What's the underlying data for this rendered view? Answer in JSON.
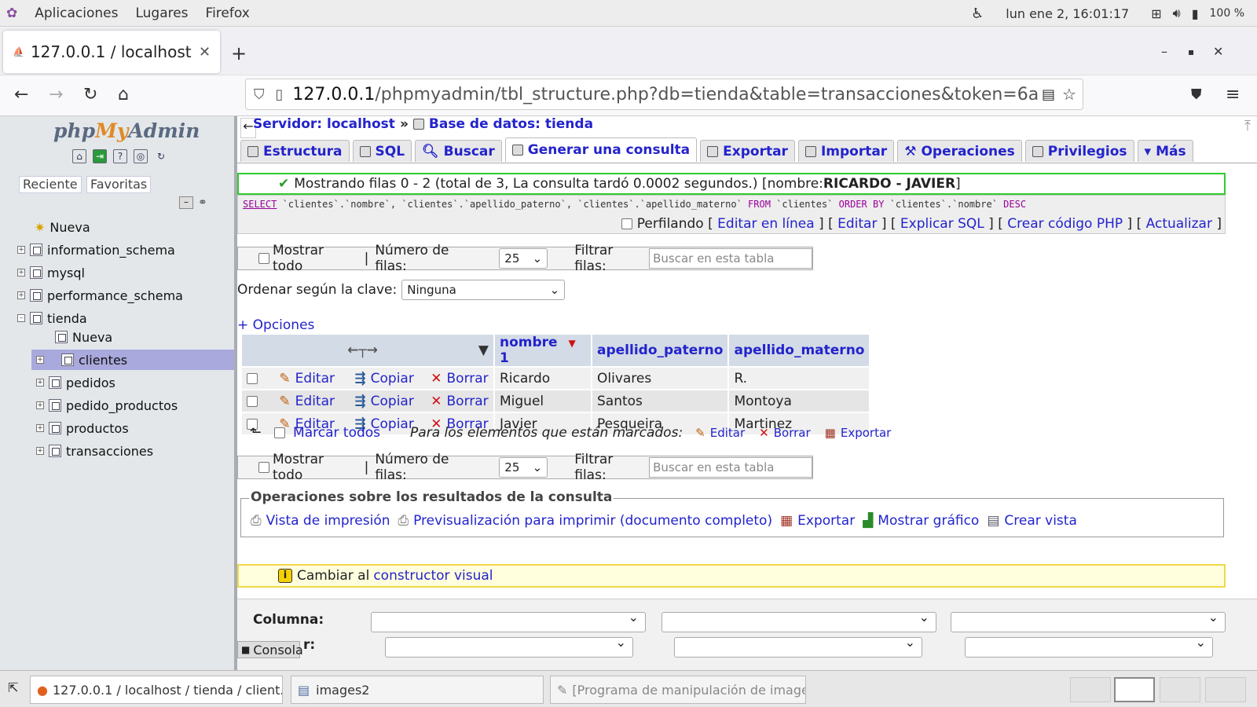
{
  "topbar": {
    "menu": [
      "Aplicaciones",
      "Lugares",
      "Firefox"
    ],
    "clock": "lun ene  2, 16:01:17",
    "battery": "100 %"
  },
  "browser": {
    "tab_title": "127.0.0.1 / localhost",
    "url_host": "127.0.0.1",
    "url_path": "/phpmyadmin/tbl_structure.php?db=tienda&table=transacciones&token=6a"
  },
  "sidebar": {
    "logo_php": "php",
    "logo_my": "My",
    "logo_admin": "Admin",
    "btn_recent": "Reciente",
    "btn_favorites": "Favoritas",
    "items": [
      {
        "label": "Nueva",
        "level": 0
      },
      {
        "label": "information_schema",
        "level": 0
      },
      {
        "label": "mysql",
        "level": 0
      },
      {
        "label": "performance_schema",
        "level": 0
      },
      {
        "label": "tienda",
        "level": 0
      },
      {
        "label": "Nueva",
        "level": 1
      },
      {
        "label": "clientes",
        "level": 1
      },
      {
        "label": "pedidos",
        "level": 1
      },
      {
        "label": "pedido_productos",
        "level": 1
      },
      {
        "label": "productos",
        "level": 1
      },
      {
        "label": "transacciones",
        "level": 1
      }
    ]
  },
  "breadcrumb": {
    "server": "Servidor: localhost",
    "sep": "»",
    "db": "Base de datos: tienda"
  },
  "tabs": [
    "Estructura",
    "SQL",
    "Buscar",
    "Generar una consulta",
    "Exportar",
    "Importar",
    "Operaciones",
    "Privilegios",
    "Más"
  ],
  "success": {
    "text": "Mostrando filas 0 - 2 (total de 3, La consulta tardó 0.0002 segundos.) [nombre: ",
    "bold": "RICARDO - JAVIER",
    "end": "]"
  },
  "sql": {
    "select_kw": "SELECT",
    "columns": " `clientes`.`nombre`, `clientes`.`apellido_paterno`, `clientes`.`apellido_materno` ",
    "from_kw": "FROM",
    "table": " `clientes` ",
    "order_kw": "ORDER BY",
    "order_col": " `clientes`.`nombre` ",
    "desc_kw": "DESC"
  },
  "sql_actions": {
    "profiling": "Perfilando",
    "edit_inline": "Editar en línea",
    "edit": "Editar",
    "explain": "Explicar SQL",
    "php_code": "Crear código PHP",
    "refresh": "Actualizar"
  },
  "navigation": {
    "show_all": "Mostrar todo",
    "rows_label": "Número de filas:",
    "rows_value": "25",
    "filter_label": "Filtrar filas:",
    "filter_placeholder": "Buscar en esta tabla"
  },
  "sort": {
    "label": "Ordenar según la clave:",
    "value": "Ninguna"
  },
  "options_link": "+ Opciones",
  "table": {
    "headers": [
      "nombre",
      "apellido_paterno",
      "apellido_materno"
    ],
    "sort_marker": "1",
    "action_labels": {
      "edit": "Editar",
      "copy": "Copiar",
      "delete": "Borrar"
    },
    "rows": [
      [
        "Ricardo",
        "Olivares",
        "R."
      ],
      [
        "Miguel",
        "Santos",
        "Montoya"
      ],
      [
        "Javier",
        "Pesqueira",
        "Martinez"
      ]
    ]
  },
  "bulk": {
    "check_all": "Marcar todos",
    "with_selected": "Para los elementos que están marcados:",
    "edit": "Editar",
    "delete": "Borrar",
    "export": "Exportar"
  },
  "query_ops": {
    "legend": "Operaciones sobre los resultados de la consulta",
    "print": "Vista de impresión",
    "print_full": "Previsualización para imprimir (documento completo)",
    "export": "Exportar",
    "chart": "Mostrar gráfico",
    "view": "Crear vista"
  },
  "notice": {
    "text": "Cambiar al ",
    "link": "constructor visual"
  },
  "search": {
    "column_label": "Columna:",
    "order_label": "r:"
  },
  "console_label": "Consola",
  "taskbar": {
    "items": [
      "127.0.0.1 / localhost / tienda / client...",
      "images2",
      "[Programa de manipulación de image..."
    ]
  },
  "colors": {
    "link": "#2323cc",
    "success_border": "#2fcc2f",
    "notice_border": "#f0d84a",
    "selected_row": "#a9a9dd"
  }
}
